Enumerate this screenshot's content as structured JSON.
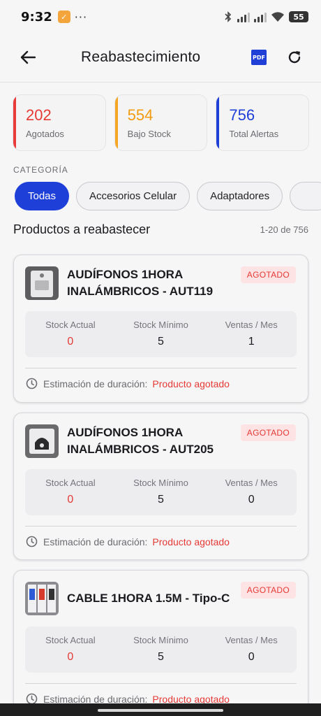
{
  "status": {
    "time": "9:32",
    "dots": "···",
    "battery": "55"
  },
  "header": {
    "title": "Reabastecimiento",
    "pdf_label": "PDF"
  },
  "stats": [
    {
      "value": "202",
      "label": "Agotados",
      "color": "#e53935"
    },
    {
      "value": "554",
      "label": "Bajo Stock",
      "color": "#f29b0f"
    },
    {
      "value": "756",
      "label": "Total Alertas",
      "color": "#1e3fd8"
    }
  ],
  "category": {
    "label": "CATEGORÍA",
    "chips": [
      "Todas",
      "Accesorios Celular",
      "Adaptadores"
    ],
    "selected": "Todas"
  },
  "list": {
    "title": "Productos a reabastecer",
    "range": "1-20 de 756"
  },
  "metric_labels": {
    "actual": "Stock Actual",
    "minimo": "Stock Mínimo",
    "ventas": "Ventas / Mes"
  },
  "estimate_label": "Estimación de duración:",
  "products": [
    {
      "name": "AUDÍFONOS 1HORA INALÁMBRICOS - AUT119",
      "badge": "AGOTADO",
      "stock_actual": "0",
      "stock_minimo": "5",
      "ventas_mes": "1",
      "estimate": "Producto agotado"
    },
    {
      "name": "AUDÍFONOS 1HORA INALÁMBRICOS - AUT205",
      "badge": "AGOTADO",
      "stock_actual": "0",
      "stock_minimo": "5",
      "ventas_mes": "0",
      "estimate": "Producto agotado"
    },
    {
      "name": "CABLE 1HORA 1.5M - Tipo-C",
      "badge": "AGOTADO",
      "stock_actual": "0",
      "stock_minimo": "5",
      "ventas_mes": "0",
      "estimate": "Producto agotado"
    }
  ],
  "colors": {
    "accent": "#1e3fd8",
    "danger": "#e53935",
    "warning": "#f29b0f"
  }
}
